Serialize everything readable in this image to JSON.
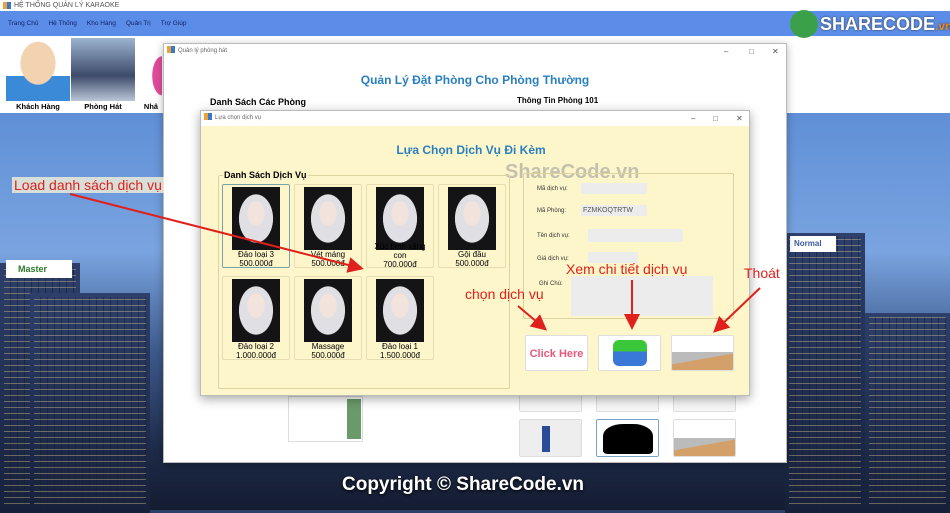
{
  "app": {
    "title": "HỆ THỐNG QUẢN LÝ KARAOKE"
  },
  "menu": [
    "Trang Chủ",
    "Hệ Thống",
    "Kho Hàng",
    "Quản Trị",
    "Trợ Giúp"
  ],
  "toolbar": [
    {
      "label": "Khách Hàng"
    },
    {
      "label": "Phòng Hát"
    },
    {
      "label": "Nhâ"
    }
  ],
  "logo": {
    "text": "SHARECODE.vn"
  },
  "room_window": {
    "title": "Quản lý phòng hát",
    "heading": "Quản Lý Đặt Phòng Cho Phòng Thường",
    "rooms_group": "Danh Sách Các Phòng",
    "info_group": "Thông Tin Phòng 101"
  },
  "badges": {
    "left": "Master",
    "right": "Normal"
  },
  "dialog": {
    "title": "Lựa chọn dịch vụ",
    "heading": "Lựa Chọn Dịch Vụ Đi Kèm",
    "watermark": "ShareCode.vn",
    "services_group": "Danh Sách Dịch Vụ",
    "services": [
      {
        "name": "Đảo loại 3",
        "price": "500.000đ"
      },
      {
        "name": "Vét máng",
        "price": "500.000đ"
      },
      {
        "name": "Xúc bình xăng con",
        "price": "700.000đ"
      },
      {
        "name": "Gội đầu",
        "price": "500.000đ"
      },
      {
        "name": "Đảo loại 2",
        "price": "1.000.000đ"
      },
      {
        "name": "Massage",
        "price": "500.000đ"
      },
      {
        "name": "Đảo loại 1",
        "price": "1.500.000đ"
      }
    ],
    "form": {
      "service_id_label": "Mã dịch vụ:",
      "service_id": "",
      "room_id_label": "Mã Phòng:",
      "room_id": "FZMKOQTRTW",
      "service_name_label": "Tên dịch vụ:",
      "service_name": "",
      "price_label": "Giá dịch vụ:",
      "price": "",
      "note_label": "Ghi Chú:",
      "note": ""
    },
    "buttons": {
      "choose": "Click Here"
    }
  },
  "annotations": {
    "load": "Load danh sách dịch vụ",
    "choose": "chọn dịch vụ",
    "detail": "Xem chi tiết dịch vụ",
    "exit": "Thoát"
  },
  "footer": {
    "copyright": "Copyright © ShareCode.vn"
  },
  "colors": {
    "menu": "#5b8de8",
    "dialog_bg": "#fdf6cb",
    "heading": "#2a7fc0",
    "annotation": "#e0201c"
  }
}
